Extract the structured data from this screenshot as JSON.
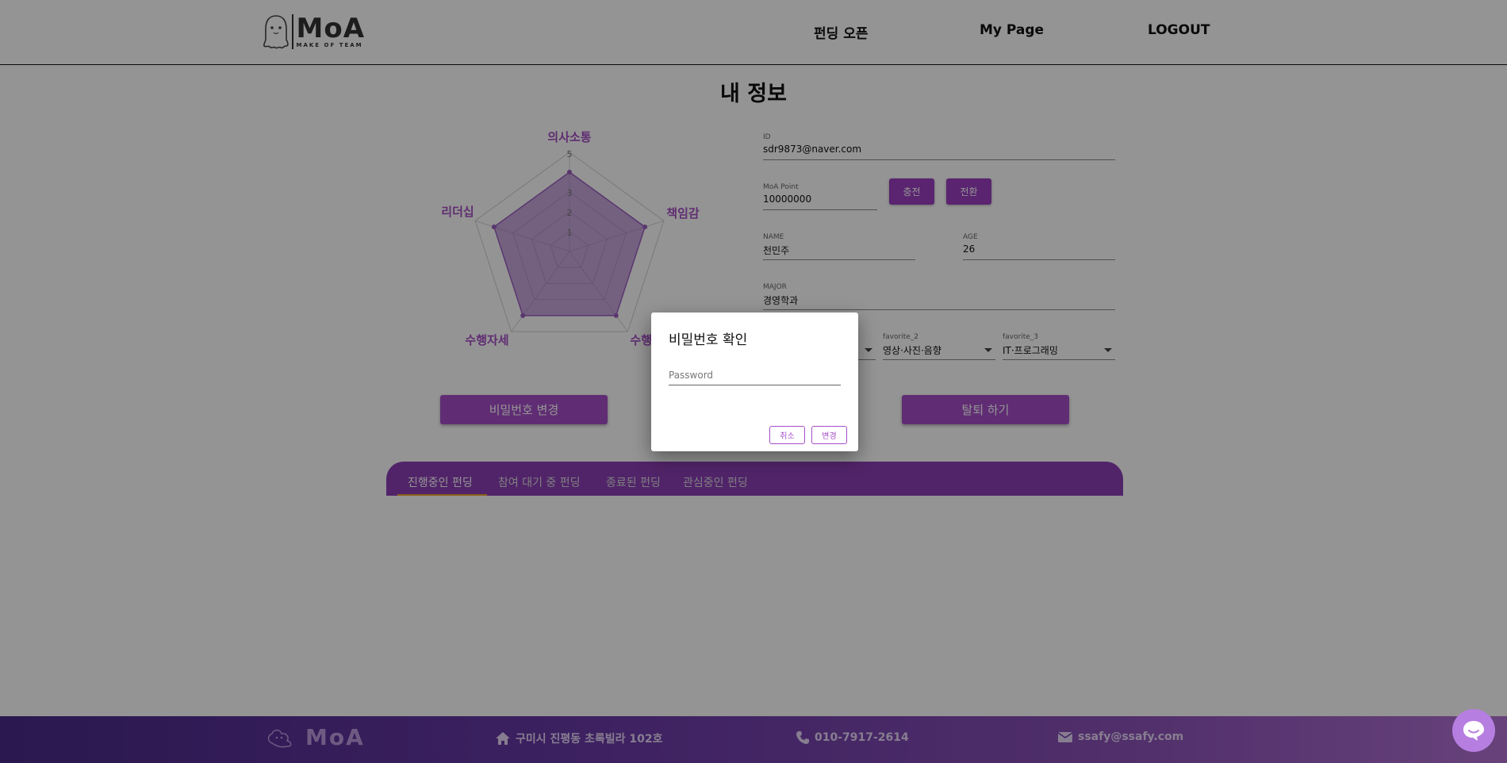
{
  "header": {
    "logo_text": "MoA",
    "logo_sub": "MAKE OF TEAM",
    "nav": [
      "펀딩 오픈",
      "My Page",
      "LOGOUT"
    ]
  },
  "page_title": "내 정보",
  "radar": {
    "axes": [
      "의사소통",
      "책임감",
      "수행능력",
      "수행자세",
      "리더십"
    ],
    "ticks": [
      "1",
      "2",
      "3",
      "5"
    ],
    "max": 5,
    "values": [
      4,
      4,
      4,
      4,
      4
    ],
    "fill_color": "#9b5fc0"
  },
  "profile": {
    "id_label": "ID",
    "id_value": "sdr9873@naver.com",
    "point_label": "MoA Point",
    "point_value": "10000000",
    "charge_button": "충전",
    "convert_button": "전환",
    "name_label": "NAME",
    "name_value": "천민주",
    "age_label": "AGE",
    "age_value": "26",
    "major_label": "MAJOR",
    "major_value": "경영학과",
    "favorite_2_label": "favorite_2",
    "favorite_2_value": "영상·사진·음향",
    "favorite_3_label": "favorite_3",
    "favorite_3_value": "IT·프로그래밍"
  },
  "buttons": {
    "change_password": "비밀번호 변경",
    "withdraw": "탈퇴 하기"
  },
  "tabs": [
    "진행중인 펀딩",
    "참여 대기 중 펀딩",
    "종료된 펀딩",
    "관심중인 펀딩"
  ],
  "footer": {
    "logo_text": "MoA",
    "address": "구미시 진평동 초록빌라 102호",
    "phone": "010-7917-2614",
    "email": "ssafy@ssafy.com"
  },
  "modal": {
    "title": "비밀번호 확인",
    "placeholder": "Password",
    "cancel": "취소",
    "confirm": "변경"
  },
  "colors": {
    "primary": "#a64ec8",
    "overlay": "rgba(0,0,0,0.42)"
  }
}
